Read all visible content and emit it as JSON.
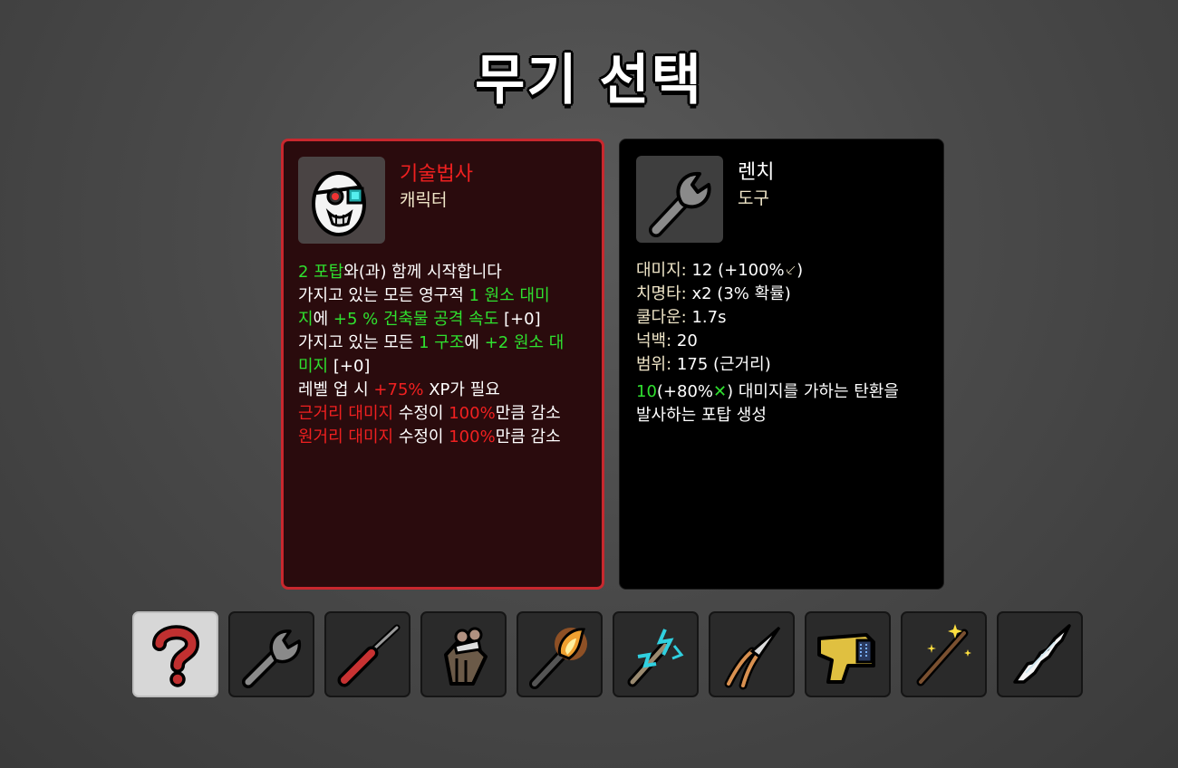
{
  "screen": {
    "title": "무기 선택"
  },
  "character": {
    "name": "기술법사",
    "type": "캐릭터",
    "portrait_icon": "egg-mage-goggles-icon",
    "description": [
      [
        {
          "t": "2 포탑",
          "c": "g"
        },
        {
          "t": "와(과) 함께 시작합니다",
          "c": "w"
        }
      ],
      [
        {
          "t": "가지고 있는 모든 영구적 ",
          "c": "w"
        },
        {
          "t": "1 원소 대미",
          "c": "g"
        }
      ],
      [
        {
          "t": "지",
          "c": "g"
        },
        {
          "t": "에 ",
          "c": "w"
        },
        {
          "t": "+5 % 건축물 공격 속도",
          "c": "g"
        },
        {
          "t": " [+0]",
          "c": "w"
        }
      ],
      [
        {
          "t": "가지고 있는 모든 ",
          "c": "w"
        },
        {
          "t": "1 구조",
          "c": "g"
        },
        {
          "t": "에 ",
          "c": "w"
        },
        {
          "t": "+2 원소 대",
          "c": "g"
        }
      ],
      [
        {
          "t": "미지",
          "c": "g"
        },
        {
          "t": " [+0]",
          "c": "w"
        }
      ],
      [
        {
          "t": "레벨 업 시 ",
          "c": "w"
        },
        {
          "t": "+75%",
          "c": "r"
        },
        {
          "t": " XP가 필요",
          "c": "w"
        }
      ],
      [
        {
          "t": "근거리 대미지",
          "c": "r"
        },
        {
          "t": " 수정이 ",
          "c": "w"
        },
        {
          "t": "100%",
          "c": "r"
        },
        {
          "t": "만큼 감소",
          "c": "w"
        }
      ],
      [
        {
          "t": "원거리 대미지",
          "c": "r"
        },
        {
          "t": " 수정이 ",
          "c": "w"
        },
        {
          "t": "100%",
          "c": "r"
        },
        {
          "t": "만큼 감소",
          "c": "w"
        }
      ]
    ]
  },
  "weapon": {
    "name": "렌치",
    "type": "도구",
    "portrait_icon": "wrench-icon",
    "stats": [
      [
        {
          "t": "대미지:",
          "c": "y"
        },
        {
          "t": " 12 (+100%",
          "c": "w"
        },
        {
          "t": "⸔",
          "c": "y"
        },
        {
          "t": ")",
          "c": "w"
        }
      ],
      [
        {
          "t": "치명타:",
          "c": "y"
        },
        {
          "t": " x2 (3% 확률)",
          "c": "w"
        }
      ],
      [
        {
          "t": "쿨다운:",
          "c": "y"
        },
        {
          "t": " 1.7s",
          "c": "w"
        }
      ],
      [
        {
          "t": "넉백:",
          "c": "y"
        },
        {
          "t": " 20",
          "c": "w"
        }
      ],
      [
        {
          "t": "범위:",
          "c": "y"
        },
        {
          "t": " 175 (근거리)",
          "c": "w"
        }
      ]
    ],
    "effect": [
      [
        {
          "t": "10",
          "c": "g"
        },
        {
          "t": "(+80%",
          "c": "w"
        },
        {
          "t": "✕",
          "c": "g"
        },
        {
          "t": ") 대미지를 가하는 탄환을",
          "c": "w"
        }
      ],
      [
        {
          "t": "발사하는 포탑 생성",
          "c": "w"
        }
      ]
    ]
  },
  "weapon_slots": [
    {
      "icon": "random-question-icon",
      "selected": true
    },
    {
      "icon": "wrench-icon",
      "selected": false
    },
    {
      "icon": "screwdriver-icon",
      "selected": false
    },
    {
      "icon": "mouse-glove-icon",
      "selected": false
    },
    {
      "icon": "torch-icon",
      "selected": false
    },
    {
      "icon": "lightning-rod-icon",
      "selected": false
    },
    {
      "icon": "pruning-shears-icon",
      "selected": false
    },
    {
      "icon": "taser-icon",
      "selected": false
    },
    {
      "icon": "magic-wand-icon",
      "selected": false
    },
    {
      "icon": "ice-blade-icon",
      "selected": false
    }
  ],
  "colors": {
    "accent_red": "#c8282e",
    "green": "#2fe02f",
    "red": "#f02020",
    "stat_label": "#f0e6c8"
  }
}
